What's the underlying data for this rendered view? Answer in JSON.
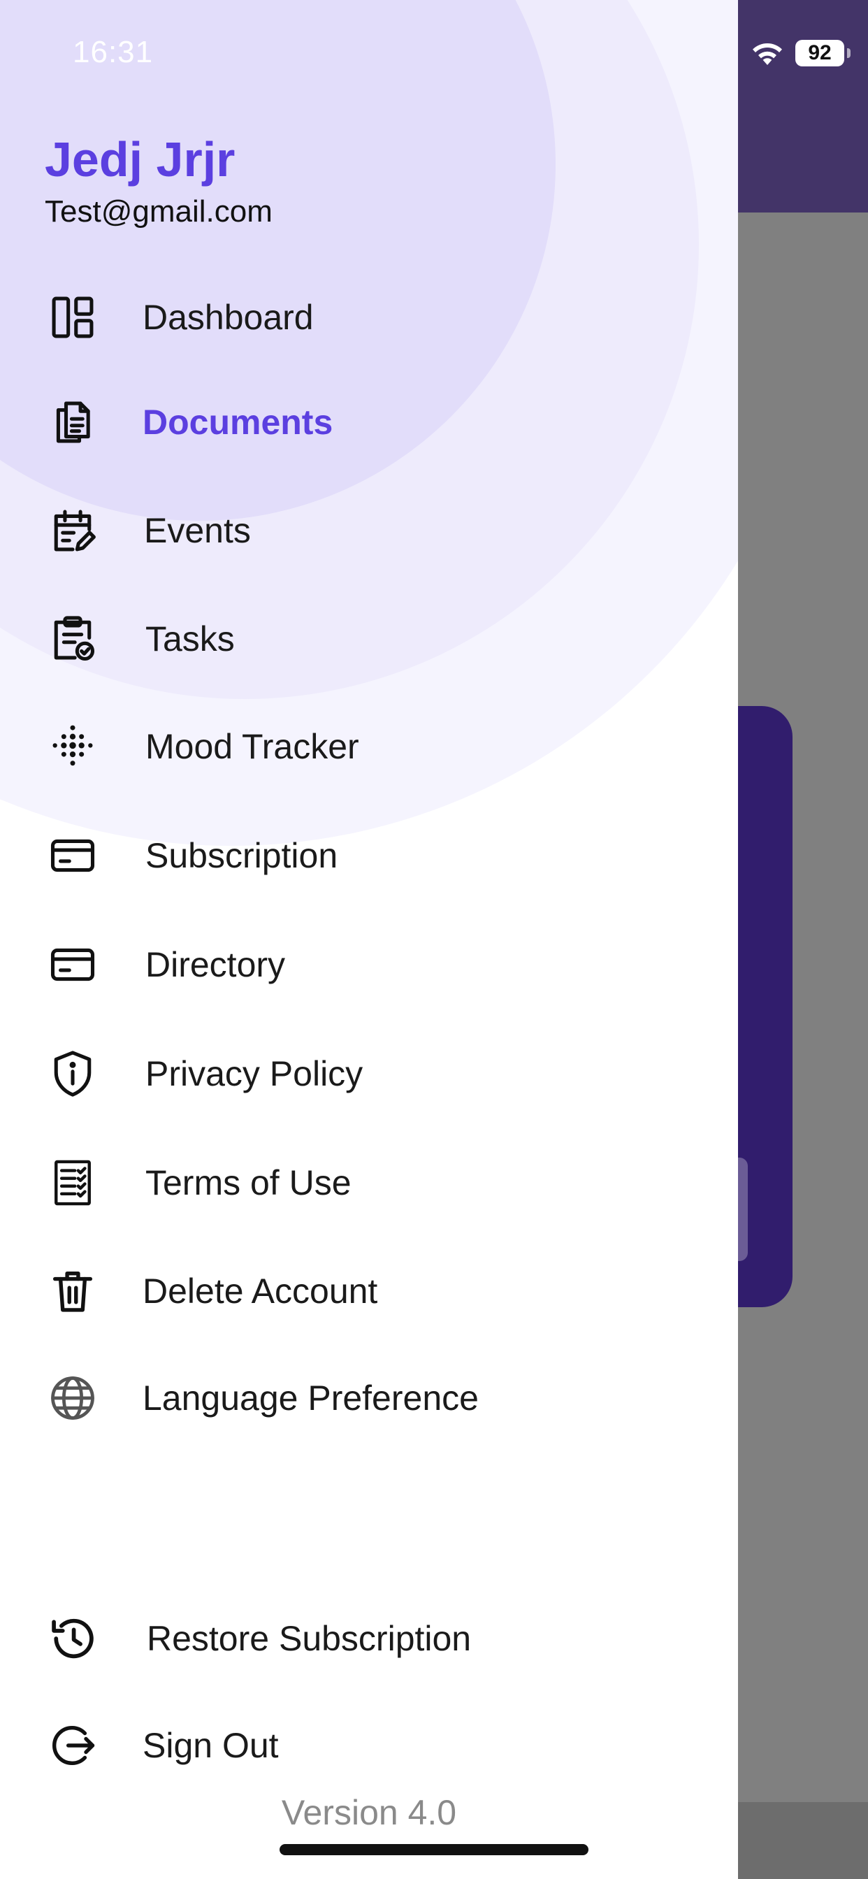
{
  "status_bar": {
    "time": "16:31",
    "battery": "92"
  },
  "user": {
    "name": "Jedj Jrjr",
    "email": "Test@gmail.com"
  },
  "menu": [
    {
      "label": "Dashboard",
      "icon": "dashboard-icon",
      "active": false
    },
    {
      "label": "Documents",
      "icon": "documents-icon",
      "active": true
    },
    {
      "label": "Events",
      "icon": "events-icon",
      "active": false
    },
    {
      "label": "Tasks",
      "icon": "tasks-icon",
      "active": false
    },
    {
      "label": "Mood Tracker",
      "icon": "mood-tracker-icon",
      "active": false
    },
    {
      "label": "Subscription",
      "icon": "credit-card-icon",
      "active": false
    },
    {
      "label": "Directory",
      "icon": "credit-card-icon",
      "active": false
    },
    {
      "label": "Privacy Policy",
      "icon": "shield-info-icon",
      "active": false
    },
    {
      "label": "Terms of Use",
      "icon": "checklist-icon",
      "active": false
    },
    {
      "label": "Delete Account",
      "icon": "trash-icon",
      "active": false
    },
    {
      "label": "Language Preference",
      "icon": "globe-icon",
      "active": false
    }
  ],
  "footer_menu": [
    {
      "label": "Restore Subscription",
      "icon": "history-icon"
    },
    {
      "label": "Sign Out",
      "icon": "sign-out-icon"
    }
  ],
  "version": "Version 4.0",
  "colors": {
    "accent": "#5B3FE0",
    "header_bg": "#433468",
    "card_bg": "#311D6D",
    "overlay": "#808080"
  }
}
